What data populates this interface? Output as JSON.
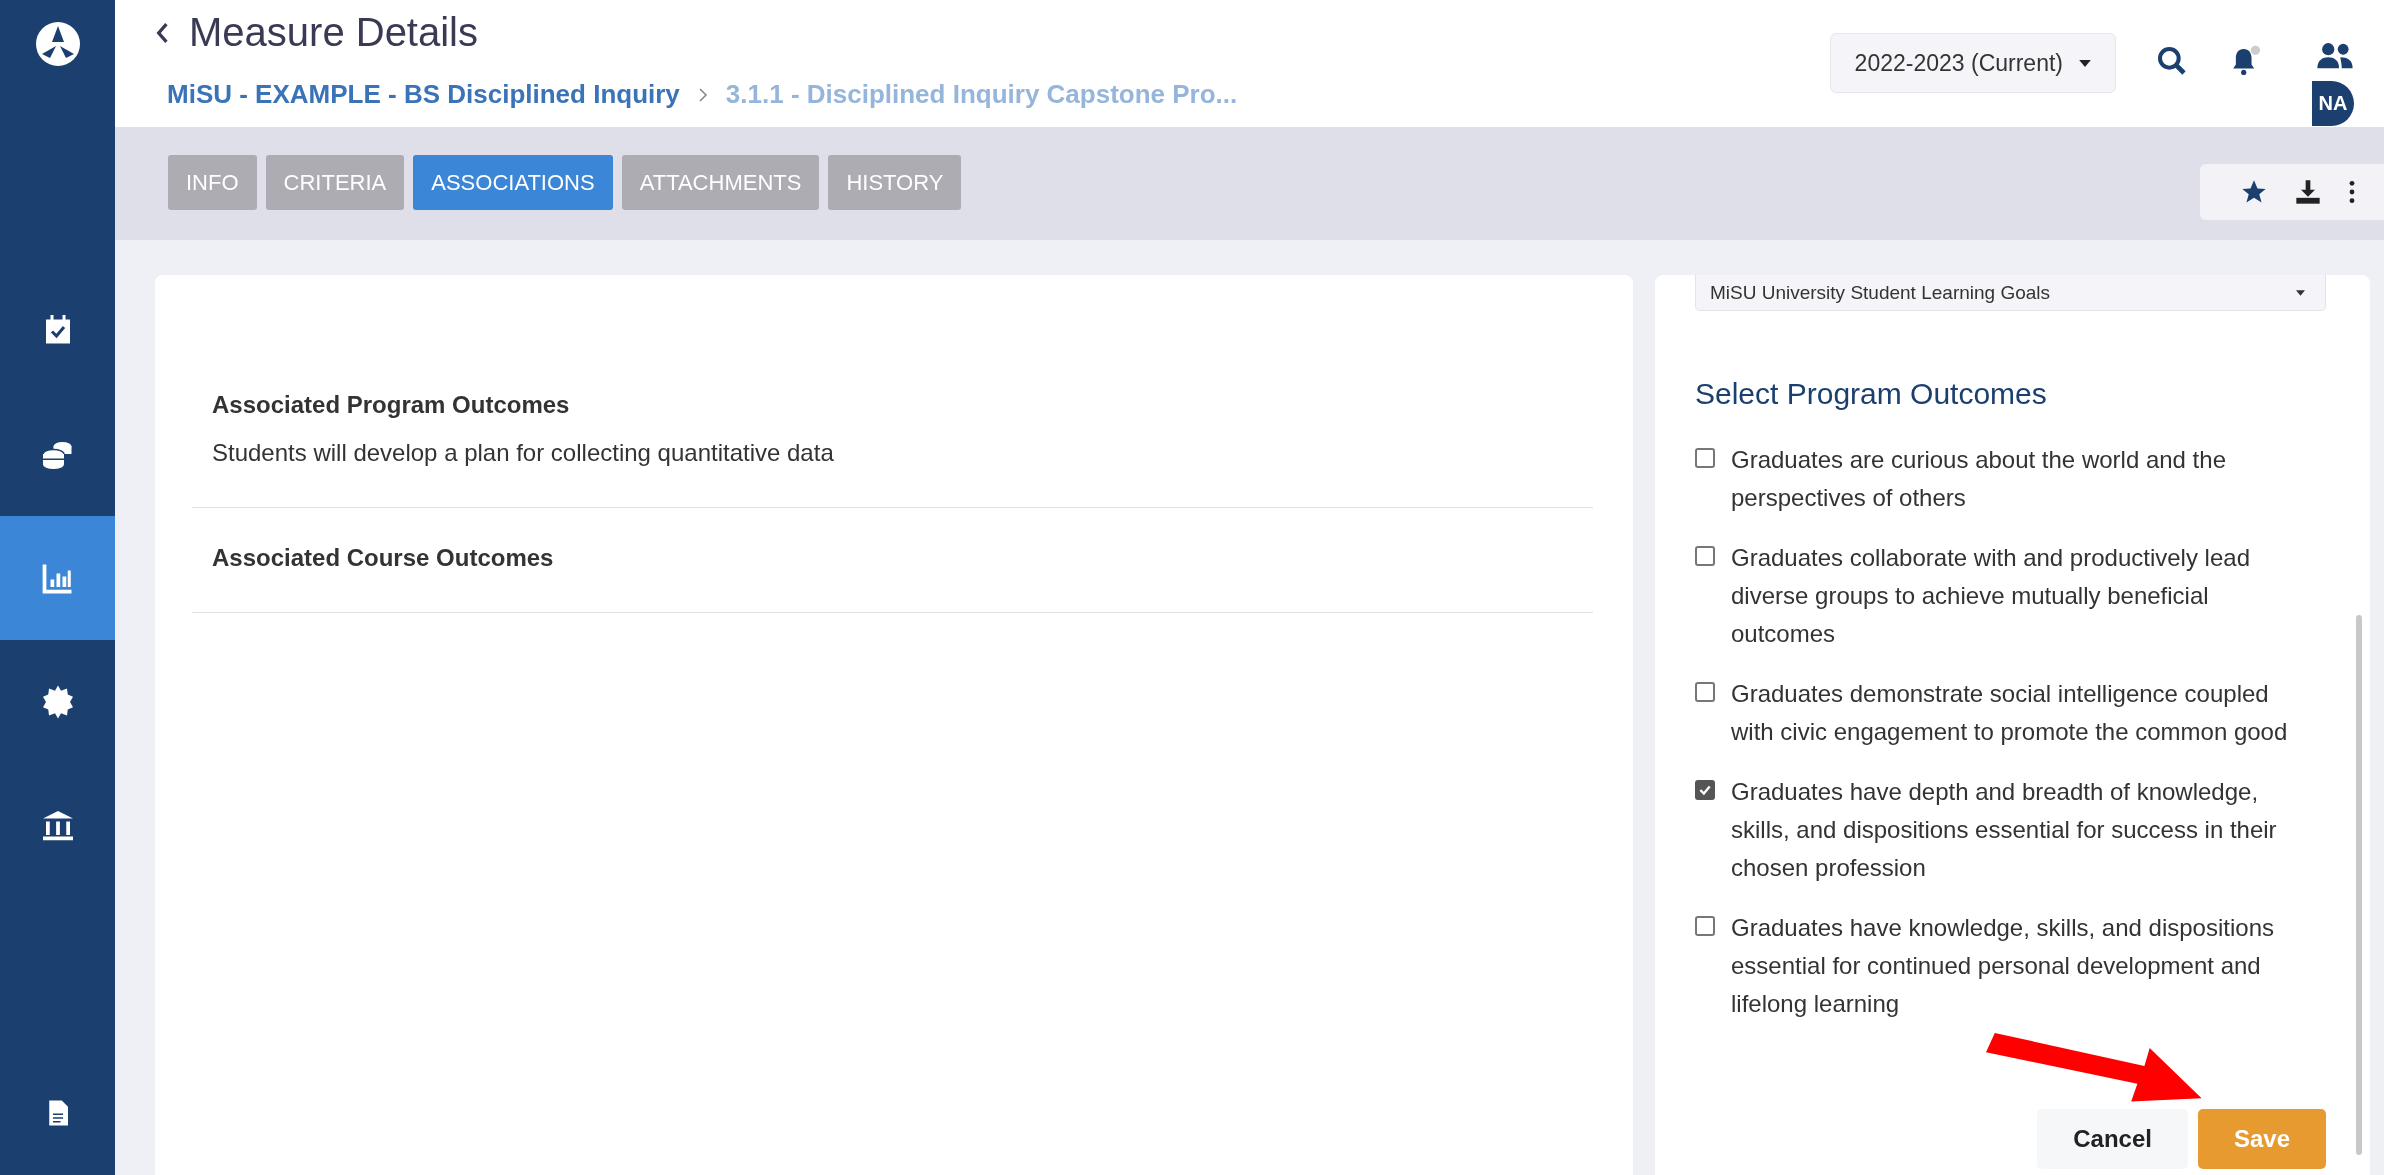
{
  "sidebar": {
    "items": [
      {
        "selected": false
      },
      {
        "selected": false
      },
      {
        "selected": true
      },
      {
        "selected": false
      },
      {
        "selected": false
      },
      {
        "selected": false
      }
    ]
  },
  "header": {
    "title": "Measure Details",
    "breadcrumb": [
      "MiSU - EXAMPLE - BS Disciplined Inquiry",
      "3.1.1 - Disciplined Inquiry Capstone Pro..."
    ],
    "year_selector": {
      "value": "2022-2023 (Current)"
    },
    "avatar": {
      "initials": "NA"
    }
  },
  "tabs": [
    {
      "label": "INFO",
      "selected": false
    },
    {
      "label": "CRITERIA",
      "selected": false
    },
    {
      "label": "ASSOCIATIONS",
      "selected": true
    },
    {
      "label": "ATTACHMENTS",
      "selected": false
    },
    {
      "label": "HISTORY",
      "selected": false
    }
  ],
  "associations": {
    "sections": [
      {
        "heading": "Associated Program Outcomes",
        "text": "Students will develop a plan for collecting quantitative data"
      },
      {
        "heading": "Associated Course Outcomes"
      }
    ]
  },
  "outcome_picker": {
    "goal_set": {
      "value": "MiSU University Student Learning Goals"
    },
    "heading": "Select Program Outcomes",
    "outcomes": [
      {
        "label": "Graduates are curious about the world and the perspectives of others",
        "checked": false
      },
      {
        "label": "Graduates collaborate with and productively lead diverse groups to achieve mutually beneficial outcomes",
        "checked": false
      },
      {
        "label": "Graduates demonstrate social intelligence coupled with civic engagement to promote the common good",
        "checked": false
      },
      {
        "label": "Graduates have depth and breadth of knowledge, skills, and dispositions essential for success in their chosen profession",
        "checked": true
      },
      {
        "label": "Graduates have knowledge, skills, and dispositions essential for continued personal development and lifelong learning",
        "checked": false
      }
    ],
    "buttons": [
      {
        "label": "Cancel",
        "kind": "secondary"
      },
      {
        "label": "Save",
        "kind": "primary"
      }
    ]
  }
}
